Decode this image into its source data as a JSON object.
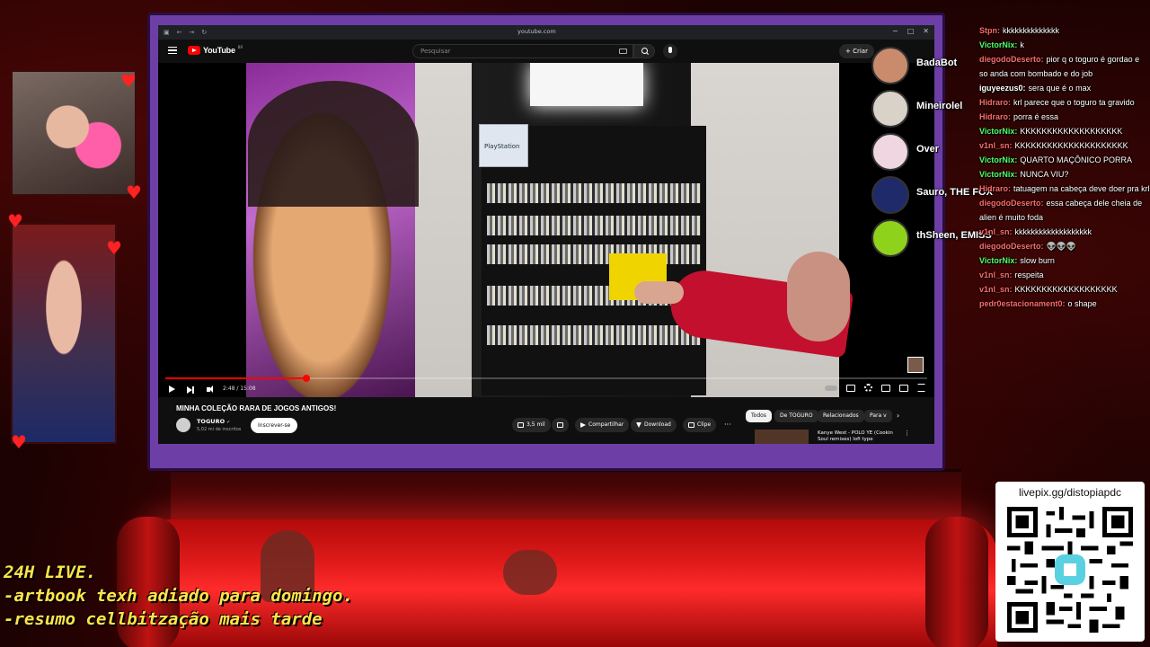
{
  "browser": {
    "url": "youtube.com",
    "controls": [
      "−",
      "□",
      "✕"
    ]
  },
  "youtube": {
    "brand": "YouTube",
    "region": "BR",
    "search_placeholder": "Pesquisar",
    "create_label": "+ Criar",
    "video": {
      "title": "MINHA COLEÇÃO RARA DE JOGOS ANTIGOS!",
      "time": "2:48 / 15:08",
      "progress": 0.185
    },
    "channel": {
      "name": "TOGURO",
      "verified": "✔",
      "subscribers": "5,02 mi de inscritos",
      "subscribe_label": "Inscrever-se"
    },
    "actions": {
      "likes": "3,5 mil",
      "share": "Compartilhar",
      "download": "Download",
      "clip": "Clipe",
      "more": "···"
    },
    "chips": [
      "Todos",
      "De TOGURO",
      "Relacionados",
      "Para v"
    ],
    "recommendation": {
      "title": "Kanye West - POLO YE (Cookin Soul remixes) lofi type"
    }
  },
  "voice_participants": [
    {
      "name": "BadaBot",
      "color": "#c98b6b"
    },
    {
      "name": "Mineirolel",
      "color": "#d9d2c8"
    },
    {
      "name": "Over",
      "color": "#f0d6e0"
    },
    {
      "name": "Sauro, THE FOX",
      "color": "#1e2a6a"
    },
    {
      "name": "thSheen, EMISS",
      "color": "#8fd21c"
    }
  ],
  "chat": [
    {
      "user": "Stpn:",
      "msg": "kkkkkkkkkkkkkk",
      "color": "#ff6a6a"
    },
    {
      "user": "VictorNix:",
      "msg": "k",
      "color": "#4cff6a"
    },
    {
      "user": "diegodoDeserto:",
      "msg": "pior q o toguro é gordao e so anda com bombado e do job",
      "color": "#ff6a6a"
    },
    {
      "user": "iguyeezus0:",
      "msg": "sera que é o max",
      "color": "#ffffff"
    },
    {
      "user": "Hidraro:",
      "msg": "krl parece que o toguro ta gravido",
      "color": "#ff6a6a"
    },
    {
      "user": "Hidraro:",
      "msg": "porra é essa",
      "color": "#ff6a6a"
    },
    {
      "user": "VictorNix:",
      "msg": "KKKKKKKKKKKKKKKKKKK",
      "color": "#4cff6a"
    },
    {
      "user": "v1nl_sn:",
      "msg": "KKKKKKKKKKKKKKKKKKKKK",
      "color": "#ff6a6a"
    },
    {
      "user": "VictorNix:",
      "msg": "QUARTO MAÇÔNICO PORRA",
      "color": "#4cff6a"
    },
    {
      "user": "VictorNix:",
      "msg": "NUNCA VIU?",
      "color": "#4cff6a"
    },
    {
      "user": "Hidraro:",
      "msg": "tatuagem na cabeça deve doer pra krl",
      "color": "#ff6a6a"
    },
    {
      "user": "diegodoDeserto:",
      "msg": "essa cabeça dele cheia de alien é muito foda",
      "color": "#ff6a6a"
    },
    {
      "user": "v1nl_sn:",
      "msg": "kkkkkkkkkkkkkkkkkkk",
      "color": "#ff6a6a"
    },
    {
      "user": "diegodoDeserto:",
      "msg": "👽👽👽",
      "color": "#ff6a6a"
    },
    {
      "user": "VictorNix:",
      "msg": "slow burn",
      "color": "#4cff6a"
    },
    {
      "user": "v1nl_sn:",
      "msg": "respeita",
      "color": "#ff6a6a"
    },
    {
      "user": "v1nl_sn:",
      "msg": "KKKKKKKKKKKKKKKKKKK",
      "color": "#ff6a6a"
    },
    {
      "user": "pedr0estacionament0:",
      "msg": "o shape",
      "color": "#ff6a6a"
    }
  ],
  "livepix": {
    "label": "livepix.gg/distopiapdc"
  },
  "notes": [
    "24H LIVE.",
    "-artbook texh adiado para domingo.",
    "-resumo cellbitzação mais tarde"
  ],
  "colors": {
    "overlay_red": "#e21b1b",
    "frame_purple": "#6d3fa6",
    "youtube_red": "#ff0000",
    "notes_yellow": "#ffe34a"
  }
}
